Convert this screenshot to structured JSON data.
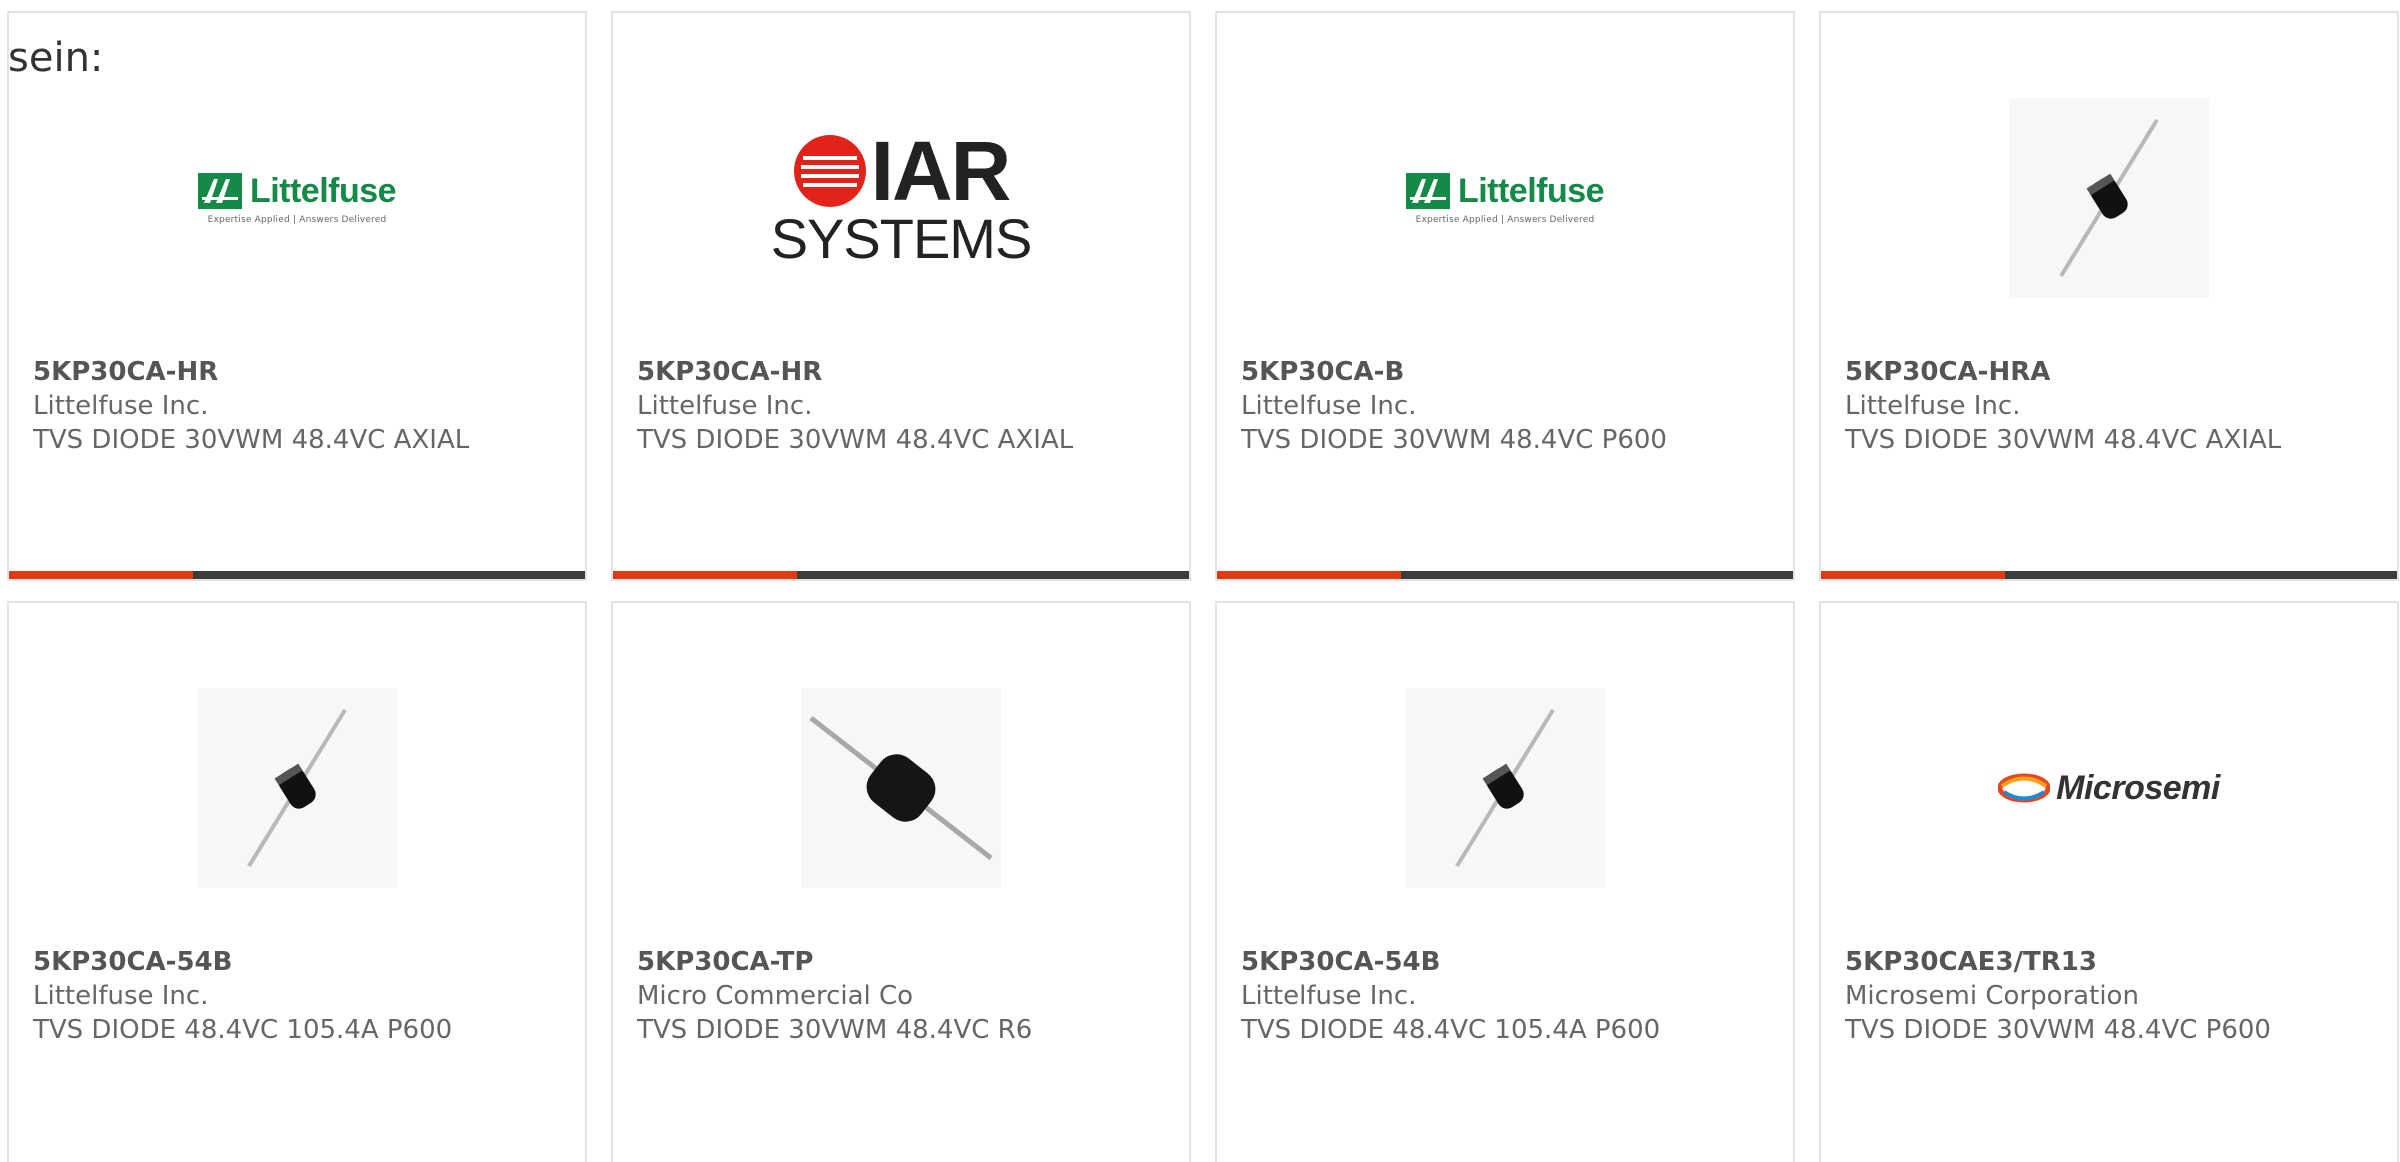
{
  "intro_text": "sein:",
  "colors": {
    "accent": "#e03a14",
    "bar": "#3c3c3c",
    "text": "#666666",
    "littelfuse_green": "#138a47",
    "iar_red": "#e2231a"
  },
  "brand_logos": {
    "littelfuse": {
      "name": "Littelfuse",
      "tagline": "Expertise Applied | Answers Delivered"
    },
    "iar": {
      "name": "IAR",
      "sub": "SYSTEMS"
    },
    "microsemi": {
      "name": "Microsemi"
    }
  },
  "products": [
    {
      "part": "5KP30CA-HR",
      "manufacturer": "Littelfuse Inc.",
      "description": "TVS DIODE 30VWM 48.4VC AXIAL",
      "image": "littelfuse-logo",
      "accent_progress": 0.32
    },
    {
      "part": "5KP30CA-HR",
      "manufacturer": "Littelfuse Inc.",
      "description": "TVS DIODE 30VWM 48.4VC AXIAL",
      "image": "iar-systems-logo",
      "accent_progress": 0.32
    },
    {
      "part": "5KP30CA-B",
      "manufacturer": "Littelfuse Inc.",
      "description": "TVS DIODE 30VWM 48.4VC P600",
      "image": "littelfuse-logo",
      "accent_progress": 0.32
    },
    {
      "part": "5KP30CA-HRA",
      "manufacturer": "Littelfuse Inc.",
      "description": "TVS DIODE 30VWM 48.4VC AXIAL",
      "image": "axial-diode-photo",
      "accent_progress": 0.32
    },
    {
      "part": "5KP30CA-54B",
      "manufacturer": "Littelfuse Inc.",
      "description": "TVS DIODE 48.4VC 105.4A P600",
      "image": "axial-diode-photo"
    },
    {
      "part": "5KP30CA-TP",
      "manufacturer": "Micro Commercial Co",
      "description": "TVS DIODE 30VWM 48.4VC R6",
      "image": "large-axial-diode-photo"
    },
    {
      "part": "5KP30CA-54B",
      "manufacturer": "Littelfuse Inc.",
      "description": "TVS DIODE 48.4VC 105.4A P600",
      "image": "axial-diode-photo"
    },
    {
      "part": "5KP30CAE3/TR13",
      "manufacturer": "Microsemi Corporation",
      "description": "TVS DIODE 30VWM 48.4VC P600",
      "image": "microsemi-logo"
    }
  ]
}
